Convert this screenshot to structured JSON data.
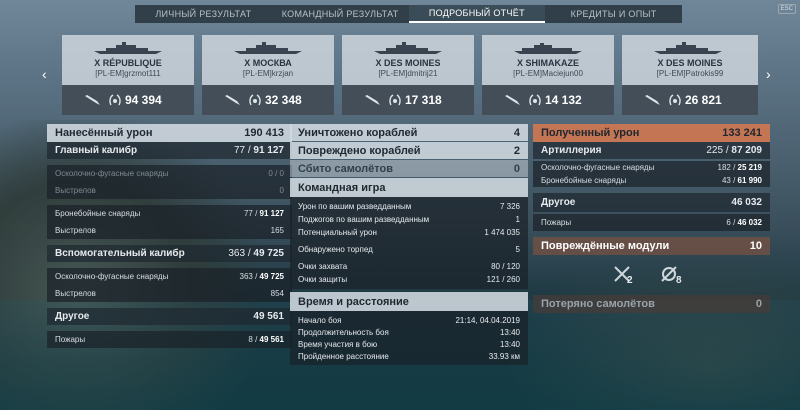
{
  "tabs": [
    "ЛИЧНЫЙ РЕЗУЛЬТАТ",
    "КОМАНДНЫЙ РЕЗУЛЬТАТ",
    "ПОДРОБНЫЙ ОТЧЁТ",
    "КРЕДИТЫ И ОПЫТ"
  ],
  "esc": "ESC",
  "cards": [
    {
      "name": "X RÉPUBLIQUE",
      "player": "[PL-EM]grzmot111",
      "damage": "94 394"
    },
    {
      "name": "X МОСКВА",
      "player": "[PL-EM]krzjan",
      "damage": "32 348"
    },
    {
      "name": "X DES MOINES",
      "player": "[PL-EM]dmitrij21",
      "damage": "17 318"
    },
    {
      "name": "X SHIMAKAZE",
      "player": "[PL-EM]Maciejun00",
      "damage": "14 132"
    },
    {
      "name": "X DES MOINES",
      "player": "[PL-EM]Patrokis99",
      "damage": "26 821"
    }
  ],
  "left": {
    "dealt": {
      "label": "Нанесённый урон",
      "value": "190 413"
    },
    "main": {
      "label": "Главный калибр",
      "v1": "77 / ",
      "v2": "91 127"
    },
    "he": {
      "label": "Осколочно-фугасные снаряды",
      "value": "0 / 0"
    },
    "he_shots": {
      "label": "Выстрелов",
      "value": "0"
    },
    "ap": {
      "label": "Бронебойные снаряды",
      "v1": "77 / ",
      "v2": "91 127"
    },
    "ap_shots": {
      "label": "Выстрелов",
      "value": "165"
    },
    "sec": {
      "label": "Вспомогательный калибр",
      "v1": "363 / ",
      "v2": "49 725"
    },
    "sec_he": {
      "label": "Осколочно-фугасные снаряды",
      "v1": "363 / ",
      "v2": "49 725"
    },
    "sec_shots": {
      "label": "Выстрелов",
      "value": "854"
    },
    "other": {
      "label": "Другое",
      "value": "49 561"
    },
    "fires": {
      "label": "Пожары",
      "v1": "8 / ",
      "v2": "49 561"
    }
  },
  "mid": {
    "destroyed": {
      "label": "Уничтожено кораблей",
      "value": "4"
    },
    "damaged": {
      "label": "Повреждено кораблей",
      "value": "2"
    },
    "planes": {
      "label": "Сбито самолётов",
      "value": "0"
    },
    "team": {
      "label": "Командная игра"
    },
    "spot_dmg": {
      "label": "Урон по вашим разведданным",
      "value": "7 326"
    },
    "spot_fires": {
      "label": "Поджогов по вашим разведданным",
      "value": "1"
    },
    "potential": {
      "label": "Потенциальный урон",
      "value": "1 474 035"
    },
    "torps": {
      "label": "Обнаружено торпед",
      "value": "5"
    },
    "capture": {
      "label": "Очки захвата",
      "value": "80 / 120"
    },
    "defense": {
      "label": "Очки защиты",
      "value": "121 / 260"
    },
    "time": {
      "label": "Время и расстояние"
    },
    "start": {
      "label": "Начало боя",
      "value": "21:14, 04.04.2019"
    },
    "duration": {
      "label": "Продолжительность боя",
      "value": "13:40"
    },
    "participation": {
      "label": "Время участия в бою",
      "value": "13:40"
    },
    "distance": {
      "label": "Пройденное расстояние",
      "value": "33.93 км"
    }
  },
  "right": {
    "received": {
      "label": "Полученный урон",
      "value": "133 241"
    },
    "artillery": {
      "label": "Артиллерия",
      "v1": "225 / ",
      "v2": "87 209"
    },
    "he": {
      "label": "Осколочно-фугасные снаряды",
      "v1": "182 / ",
      "v2": "25 219"
    },
    "ap": {
      "label": "Бронебойные снаряды",
      "v1": "43 / ",
      "v2": "61 990"
    },
    "other": {
      "label": "Другое",
      "value": "46 032"
    },
    "fires": {
      "label": "Пожары",
      "v1": "6 / ",
      "v2": "46 032"
    },
    "modules": {
      "label": "Повреждённые модули",
      "value": "10"
    },
    "mod_a": "2",
    "mod_b": "8",
    "lost": {
      "label": "Потеряно самолётов",
      "value": "0"
    }
  }
}
